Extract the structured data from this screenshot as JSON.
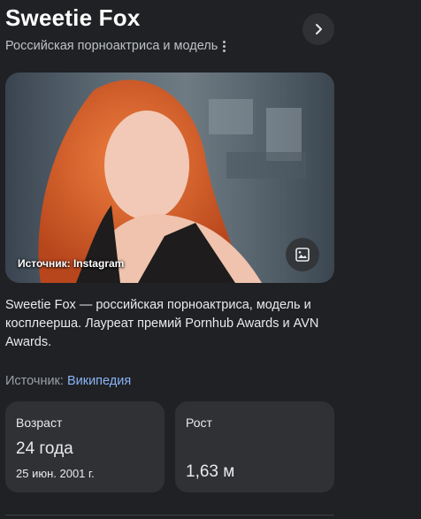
{
  "header": {
    "title": "Sweetie Fox",
    "subtitle": "Российская порноактриса и модель"
  },
  "photo": {
    "caption": "Источник: Instagram"
  },
  "description": "Sweetie Fox — российская порноактриса, модель и косплеерша. Лауреат премий Pornhub Awards и AVN Awards.",
  "source": {
    "label": "Источник:",
    "link": "Википедия"
  },
  "facts": {
    "age": {
      "label": "Возраст",
      "value": "24 года",
      "detail": "25 июн. 2001 г."
    },
    "height": {
      "label": "Рост",
      "value": "1,63 м"
    }
  },
  "colors": {
    "background": "#202124",
    "card": "#303134",
    "link": "#8ab4f8",
    "muted_text": "#9aa0a6"
  },
  "icons": [
    "more-vert-icon",
    "chevron-right-icon",
    "image-icon"
  ]
}
